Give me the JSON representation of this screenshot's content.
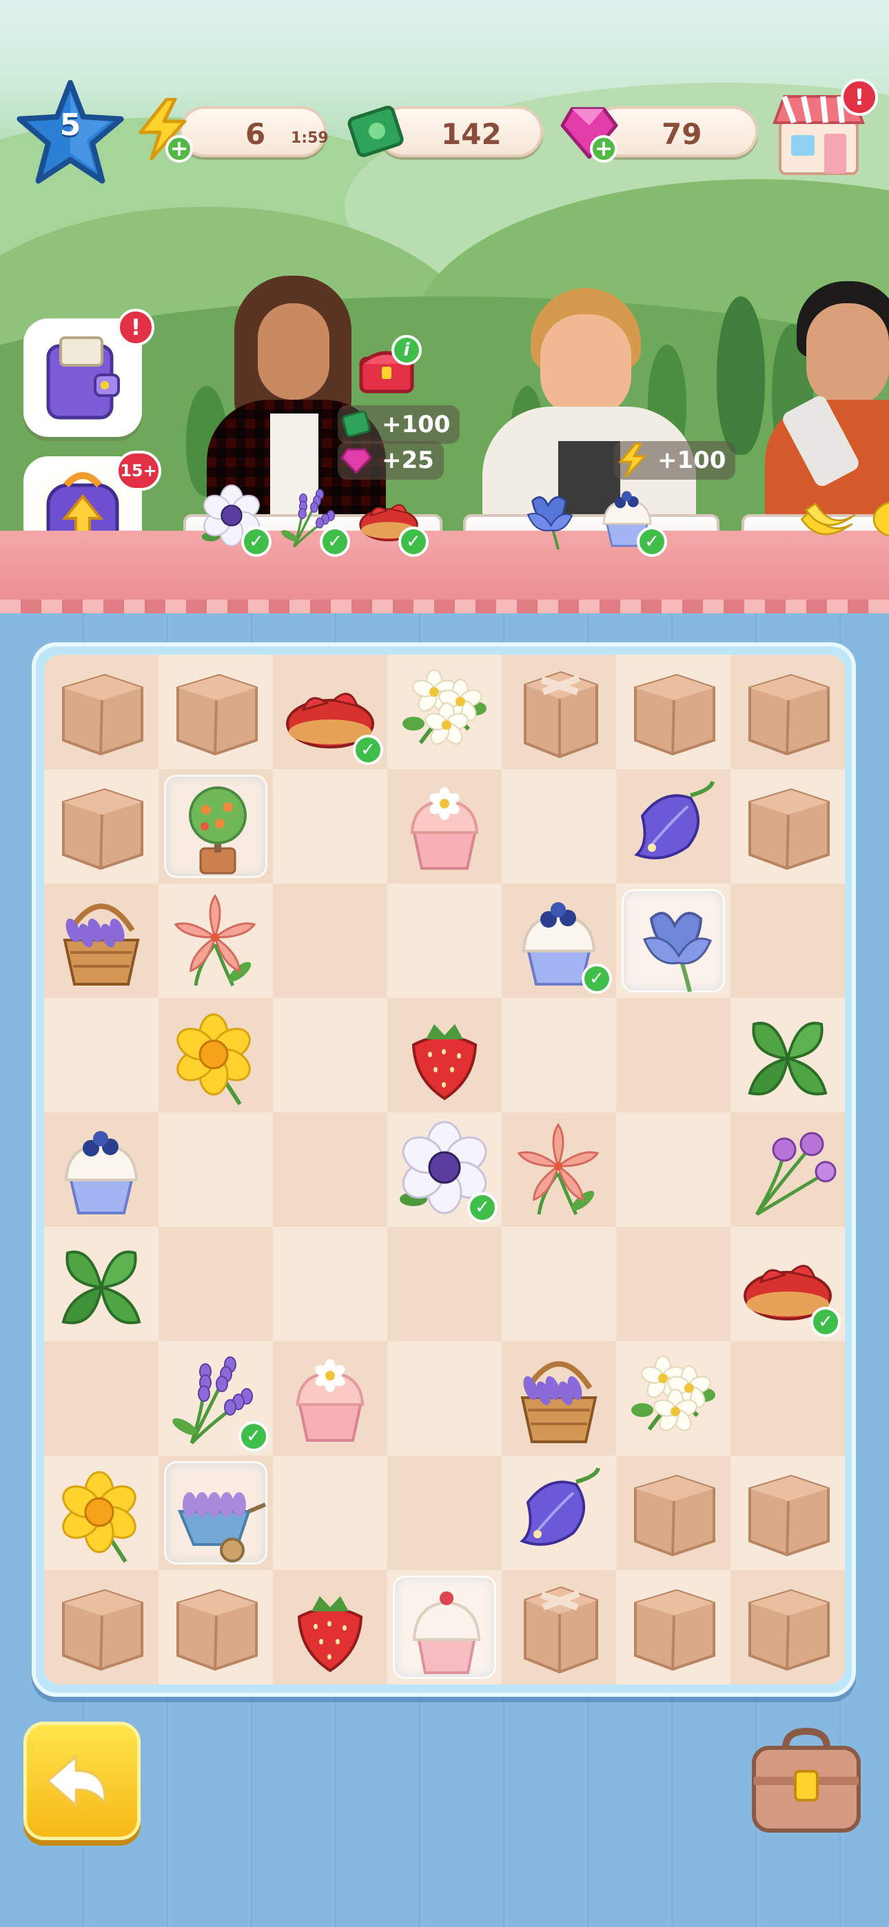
{
  "hud": {
    "level": "5",
    "energy": {
      "value": "6",
      "timer": "1:59",
      "icon": "lightning-icon"
    },
    "cash": {
      "value": "142",
      "icon": "money-icon"
    },
    "gems": {
      "value": "79",
      "icon": "gem-icon"
    },
    "shop": {
      "icon": "shop-icon",
      "alert": "!"
    }
  },
  "side_buttons": {
    "wallet": {
      "icon": "wallet-icon",
      "badge": "!"
    },
    "backpack": {
      "icon": "backpack-icon",
      "badge": "15+"
    }
  },
  "customers": [
    {
      "name": "customer-1",
      "rewards": [
        {
          "icon": "money-icon",
          "text": "+100"
        },
        {
          "icon": "gem-icon",
          "text": "+25"
        }
      ],
      "chest_info": "i",
      "order": [
        "anemone",
        "lavender",
        "eclair"
      ],
      "checked": [
        true,
        true,
        true
      ]
    },
    {
      "name": "customer-2",
      "rewards": [
        {
          "icon": "lightning-icon",
          "text": "+100"
        }
      ],
      "order": [
        "iris",
        "blueberry-cupcake"
      ],
      "checked": [
        false,
        true
      ]
    },
    {
      "name": "customer-3",
      "order": [
        "bananas",
        "lemon"
      ],
      "checked": [
        false,
        false
      ]
    }
  ],
  "board": {
    "cols": 7,
    "rows": 9,
    "grid": [
      [
        "box",
        "box",
        "eclair*",
        "jasmine",
        "box-taped",
        "box",
        "box"
      ],
      [
        "box",
        "orange-tree~",
        "",
        "cupcake-pink",
        "",
        "bellflower",
        "box"
      ],
      [
        "lavender-basket",
        "lily",
        "",
        "",
        "blueberry-cupcake*",
        "iris~",
        ""
      ],
      [
        "",
        "daffodil",
        "",
        "strawberry",
        "",
        "",
        "mint"
      ],
      [
        "blueberry-cupcake",
        "",
        "",
        "anemone*",
        "lily",
        "",
        "allium"
      ],
      [
        "mint",
        "",
        "",
        "",
        "",
        "",
        "eclair*"
      ],
      [
        "",
        "lavender*",
        "cupcake-pink",
        "",
        "lavender-basket",
        "jasmine",
        ""
      ],
      [
        "daffodil",
        "wheelbarrow~",
        "",
        "",
        "bellflower",
        "box",
        "box"
      ],
      [
        "box",
        "box",
        "strawberry",
        "cherry-cupcake~",
        "box-taped",
        "box",
        "box"
      ]
    ]
  },
  "controls": {
    "undo": "undo-arrow-icon",
    "inventory": "toolbox-icon"
  }
}
